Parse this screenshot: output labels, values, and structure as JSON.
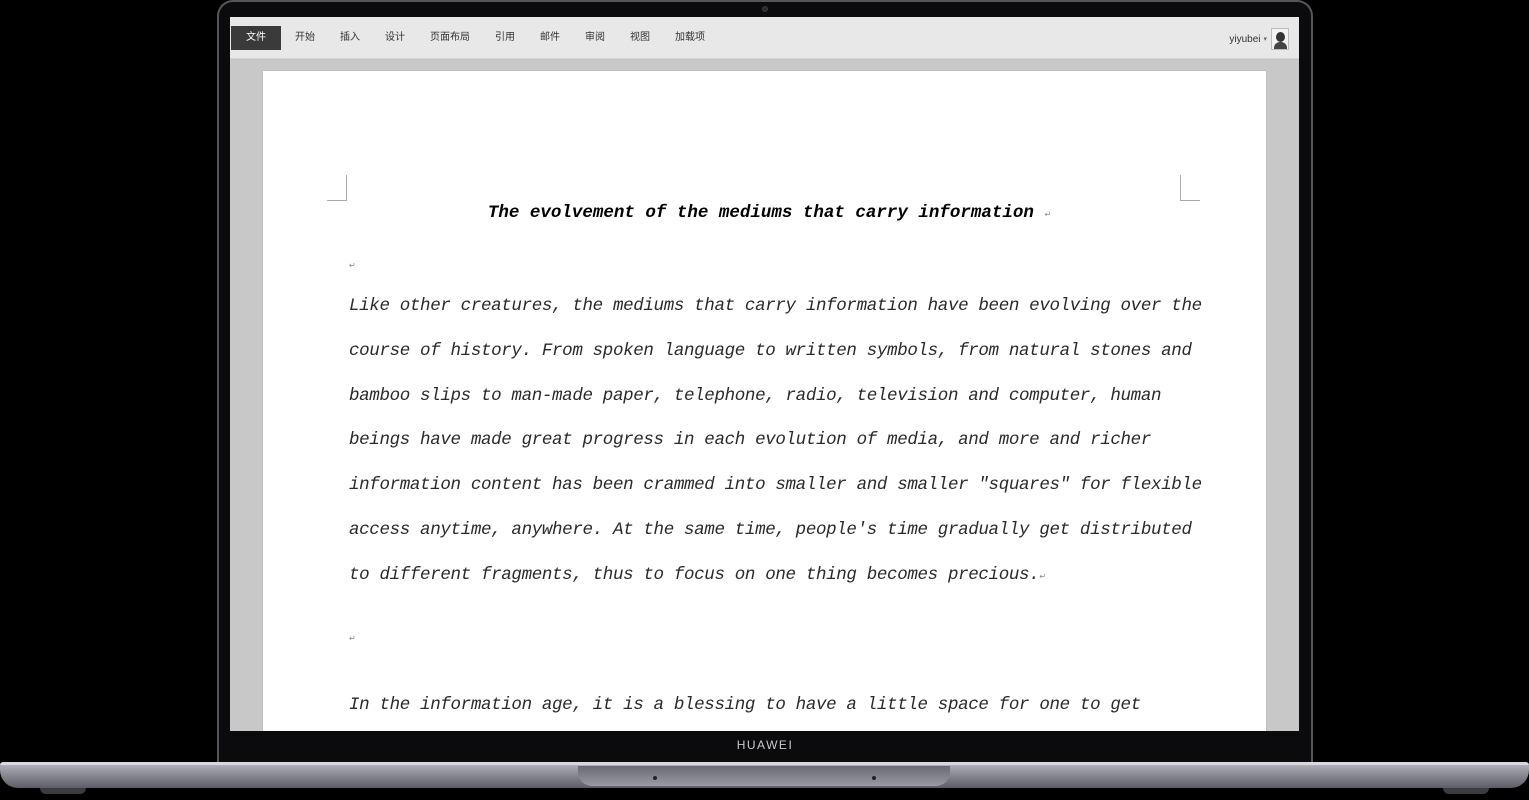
{
  "device": {
    "brand": "HUAWEI"
  },
  "ribbon": {
    "tabs": [
      "文件",
      "开始",
      "插入",
      "设计",
      "页面布局",
      "引用",
      "邮件",
      "审阅",
      "视图",
      "加载项"
    ],
    "user": {
      "name": "yiyubei",
      "caret": "▾"
    }
  },
  "document": {
    "title": "The evolvement of the mediums that carry information",
    "return_mark": "↵",
    "paragraph1": [
      "Like other creatures, the mediums that carry information have been evolving over the",
      "course of history. From spoken language to written symbols, from natural stones and",
      "bamboo slips to man-made paper, telephone, radio, television and computer, human",
      "beings have made great progress in each evolution of media, and more and richer",
      "information content has been crammed into smaller and smaller \"squares\" for flexible",
      "access anytime, anywhere. At the same time, people's time gradually get distributed",
      "to different fragments, thus to focus on one thing becomes precious."
    ],
    "paragraph2": [
      "In the information age, it is a blessing to have a little space for one to get"
    ]
  }
}
